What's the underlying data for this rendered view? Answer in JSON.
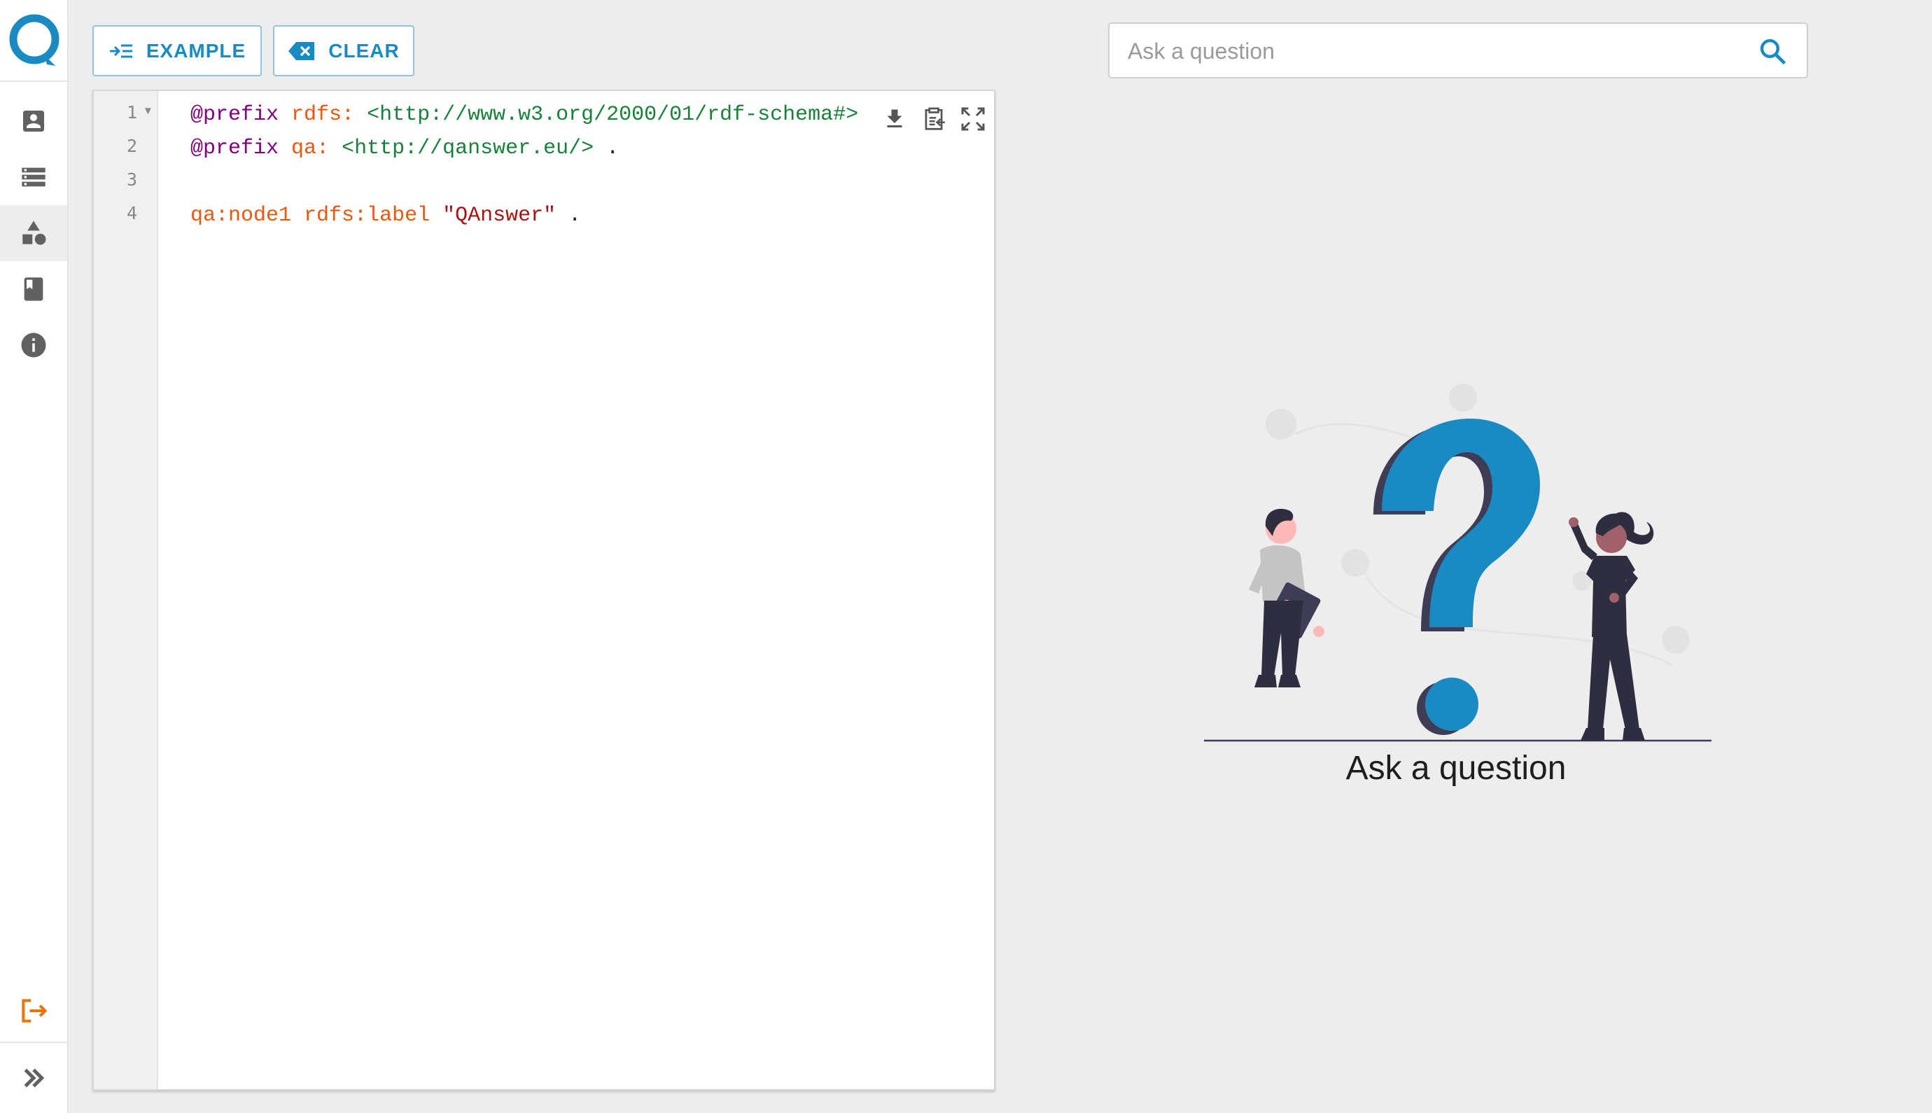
{
  "sidebar": {
    "logo": "qanswer-logo",
    "items": [
      {
        "name": "user",
        "icon": "account-box-icon"
      },
      {
        "name": "datasets",
        "icon": "storage-icon"
      },
      {
        "name": "shapes",
        "icon": "shapes-icon"
      },
      {
        "name": "docs",
        "icon": "book-icon"
      },
      {
        "name": "info",
        "icon": "info-icon"
      }
    ],
    "logout_icon": "logout-icon",
    "expand_icon": "double-chevron-right-icon"
  },
  "toolbar": {
    "example_label": "EXAMPLE",
    "clear_label": "CLEAR"
  },
  "editor": {
    "lines": [
      {
        "num": "1",
        "tokens": [
          [
            "kw",
            "@prefix"
          ],
          [
            "pl",
            " "
          ],
          [
            "pfx",
            "rdfs:"
          ],
          [
            "pl",
            " "
          ],
          [
            "iri",
            "<http://www.w3.org/2000/01/rdf-schema#>"
          ]
        ]
      },
      {
        "num": "2",
        "tokens": [
          [
            "kw",
            "@prefix"
          ],
          [
            "pl",
            " "
          ],
          [
            "pfx",
            "qa:"
          ],
          [
            "pl",
            " "
          ],
          [
            "iri",
            "<http://qanswer.eu/>"
          ],
          [
            "pl",
            " ."
          ]
        ]
      },
      {
        "num": "3",
        "tokens": []
      },
      {
        "num": "4",
        "tokens": [
          [
            "pfx",
            "qa:node1"
          ],
          [
            "pl",
            " "
          ],
          [
            "pfx",
            "rdfs:label"
          ],
          [
            "pl",
            " "
          ],
          [
            "str",
            "\"QAnswer\""
          ],
          [
            "pl",
            " ."
          ]
        ]
      }
    ]
  },
  "search": {
    "placeholder": "Ask a question"
  },
  "empty_state": {
    "caption": "Ask a question"
  },
  "colors": {
    "accent": "#1a8ac2",
    "logout": "#e8740c",
    "icon_gray": "#616161"
  }
}
